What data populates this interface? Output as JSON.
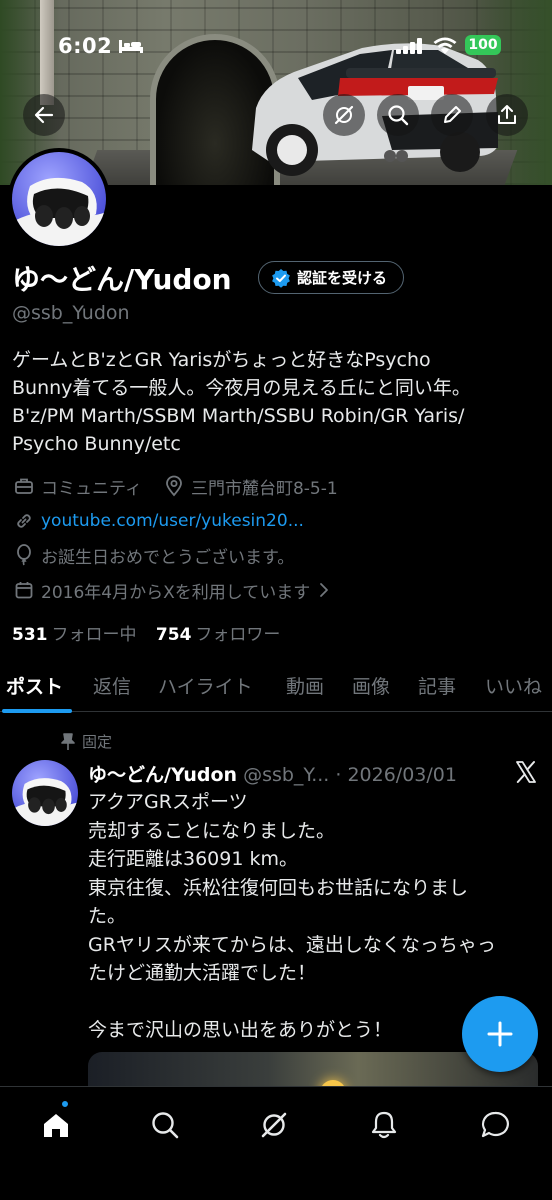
{
  "status_bar": {
    "time": "6:02",
    "battery": "100"
  },
  "profile": {
    "name": "ゆ〜どん/Yudon",
    "verify_label": "認証を受ける",
    "handle": "@ssb_Yudon",
    "bio_lines": [
      "ゲームとB'zとGR Yarisがちょっと好きなPsycho",
      "Bunny着てる一般人。今夜月の見える丘にと同い年。",
      "B'z/PM Marth/SSBM Marth/SSBU Robin/GR Yaris/",
      "Psycho Bunny/etc"
    ],
    "category": "コミュニティ",
    "location": "三門市麓台町8-5-1",
    "website": "youtube.com/user/yukesin20...",
    "birthday": "お誕生日おめでとうございます。",
    "joined": "2016年4月からXを利用しています",
    "following_count": "531",
    "following_label": "フォロー中",
    "followers_count": "754",
    "followers_label": "フォロワー"
  },
  "tabs": [
    "ポスト",
    "返信",
    "ハイライト",
    "動画",
    "画像",
    "記事",
    "いいね"
  ],
  "post": {
    "pinned_label": "固定",
    "author": "ゆ〜どん/Yudon",
    "handle": "@ssb_Y...",
    "date": "· 2026/03/01",
    "lines": [
      "アクアGRスポーツ",
      "売却することになりました。",
      "走行距離は36091 km。",
      "東京往復、浜松往復何回もお世話になりまし",
      "た。",
      "GRヤリスが来てからは、遠出しなくなっちゃっ",
      "たけど通勤大活躍でした！",
      "",
      "今まで沢山の思い出をありがとう！"
    ]
  },
  "colors": {
    "accent": "#1d9bf0",
    "muted": "#71767b",
    "background": "#000000"
  },
  "icons": {
    "top_bar": [
      "back-arrow-icon",
      "grok-icon",
      "search-icon",
      "edit-icon",
      "share-icon"
    ],
    "bottom_nav": [
      "home-icon",
      "search-icon",
      "grok-icon",
      "notifications-icon",
      "messages-icon"
    ]
  }
}
